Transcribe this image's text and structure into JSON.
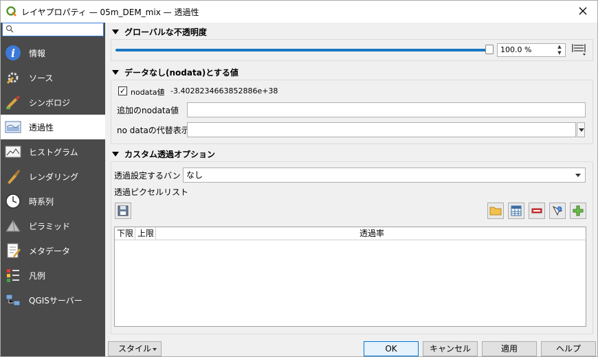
{
  "window": {
    "title": "レイヤプロパティ — 05m_DEM_mix — 透過性"
  },
  "search": {
    "placeholder": ""
  },
  "sidebar": {
    "items": [
      {
        "label": "情報",
        "icon": "info-icon"
      },
      {
        "label": "ソース",
        "icon": "source-icon"
      },
      {
        "label": "シンボロジ",
        "icon": "symbology-icon"
      },
      {
        "label": "透過性",
        "icon": "transparency-icon",
        "active": true
      },
      {
        "label": "ヒストグラム",
        "icon": "histogram-icon"
      },
      {
        "label": "レンダリング",
        "icon": "rendering-icon"
      },
      {
        "label": "時系列",
        "icon": "clock-icon"
      },
      {
        "label": "ピラミッド",
        "icon": "pyramid-icon"
      },
      {
        "label": "メタデータ",
        "icon": "metadata-icon"
      },
      {
        "label": "凡例",
        "icon": "legend-icon"
      },
      {
        "label": "QGISサーバー",
        "icon": "server-icon"
      }
    ]
  },
  "global_opacity": {
    "heading": "グローバルな不透明度",
    "value_text": "100.0 %",
    "level_percent": 100
  },
  "nodata": {
    "heading": "データなし(nodata)とする値",
    "checkbox_label": "nodata値",
    "checkbox_checked": true,
    "nodata_value": "-3.4028234663852886e+38",
    "additional_label": "追加のnodata値",
    "additional_value": "",
    "display_label": "no dataの代替表示",
    "display_value": ""
  },
  "custom": {
    "heading": "カスタム透過オプション",
    "band_label": "透過設定するバンド",
    "band_value": "なし",
    "pixel_list_label": "透過ピクセルリスト",
    "table_headers": [
      "下限",
      "上限",
      "透過率"
    ]
  },
  "buttons": {
    "style": "スタイル",
    "ok": "OK",
    "cancel": "キャンセル",
    "apply": "適用",
    "help": "ヘルプ"
  },
  "colors": {
    "sidebar_bg": "#4a4a4a",
    "slider_fill": "#1a78c2",
    "ok_border": "#0078d7"
  }
}
